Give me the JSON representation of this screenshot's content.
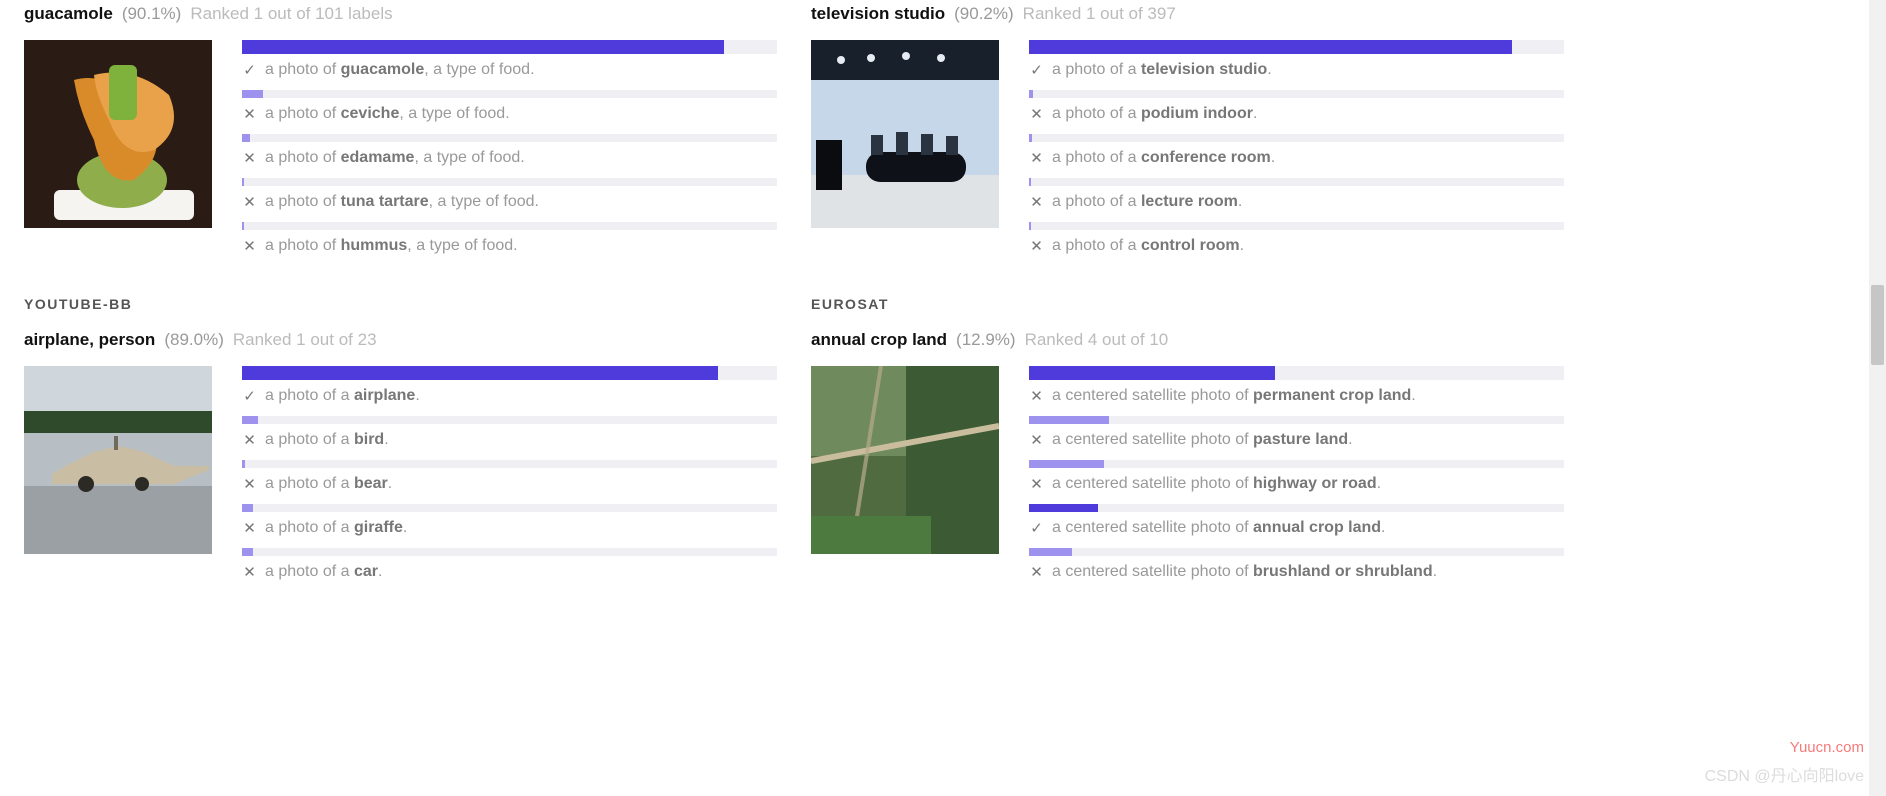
{
  "panels": [
    {
      "dataset_header": "",
      "label": "guacamole",
      "confidence": "(90.1%)",
      "rank": "Ranked 1 out of 101 labels",
      "predictions": [
        {
          "correct": true,
          "pct": 90.1,
          "prefix": "a photo of ",
          "term": "guacamole",
          "suffix": ", a type of food."
        },
        {
          "correct": false,
          "pct": 4.0,
          "prefix": "a photo of ",
          "term": "ceviche",
          "suffix": ", a type of food."
        },
        {
          "correct": false,
          "pct": 1.5,
          "prefix": "a photo of ",
          "term": "edamame",
          "suffix": ", a type of food."
        },
        {
          "correct": false,
          "pct": 0.4,
          "prefix": "a photo of ",
          "term": "tuna tartare",
          "suffix": ", a type of food."
        },
        {
          "correct": false,
          "pct": 0.4,
          "prefix": "a photo of ",
          "term": "hummus",
          "suffix": ", a type of food."
        }
      ]
    },
    {
      "dataset_header": "",
      "label": "television studio",
      "confidence": "(90.2%)",
      "rank": "Ranked 1 out of 397",
      "predictions": [
        {
          "correct": true,
          "pct": 90.2,
          "prefix": "a photo of a ",
          "term": "television studio",
          "suffix": "."
        },
        {
          "correct": false,
          "pct": 0.8,
          "prefix": "a photo of a ",
          "term": "podium indoor",
          "suffix": "."
        },
        {
          "correct": false,
          "pct": 0.5,
          "prefix": "a photo of a ",
          "term": "conference room",
          "suffix": "."
        },
        {
          "correct": false,
          "pct": 0.4,
          "prefix": "a photo of a ",
          "term": "lecture room",
          "suffix": "."
        },
        {
          "correct": false,
          "pct": 0.4,
          "prefix": "a photo of a ",
          "term": "control room",
          "suffix": "."
        }
      ]
    },
    {
      "dataset_header": "YOUTUBE-BB",
      "label": "airplane, person",
      "confidence": "(89.0%)",
      "rank": "Ranked 1 out of 23",
      "predictions": [
        {
          "correct": true,
          "pct": 89.0,
          "prefix": "a photo of a ",
          "term": "airplane",
          "suffix": "."
        },
        {
          "correct": false,
          "pct": 3.0,
          "prefix": "a photo of a ",
          "term": "bird",
          "suffix": "."
        },
        {
          "correct": false,
          "pct": 0.6,
          "prefix": "a photo of a ",
          "term": "bear",
          "suffix": "."
        },
        {
          "correct": false,
          "pct": 2.0,
          "prefix": "a photo of a ",
          "term": "giraffe",
          "suffix": "."
        },
        {
          "correct": false,
          "pct": 2.0,
          "prefix": "a photo of a ",
          "term": "car",
          "suffix": "."
        }
      ]
    },
    {
      "dataset_header": "EUROSAT",
      "label": "annual crop land",
      "confidence": "(12.9%)",
      "rank": "Ranked 4 out of 10",
      "predictions": [
        {
          "correct": false,
          "pct": 46.0,
          "prefix": "a centered satellite photo of ",
          "term": "permanent crop land",
          "suffix": "."
        },
        {
          "correct": false,
          "pct": 15.0,
          "prefix": "a centered satellite photo of ",
          "term": "pasture land",
          "suffix": "."
        },
        {
          "correct": false,
          "pct": 14.0,
          "prefix": "a centered satellite photo of ",
          "term": "highway or road",
          "suffix": "."
        },
        {
          "correct": true,
          "pct": 12.9,
          "prefix": "a centered satellite photo of ",
          "term": "annual crop land",
          "suffix": "."
        },
        {
          "correct": false,
          "pct": 8.0,
          "prefix": "a centered satellite photo of ",
          "term": "brushland or shrubland",
          "suffix": "."
        }
      ]
    }
  ],
  "watermark": {
    "top": "Yuucn.com",
    "bottom": "CSDN @丹心向阳love"
  },
  "icons": {
    "correct": "✓",
    "incorrect": "✕"
  },
  "thumbs": [
    "<svg width='188' height='188' viewBox='0 0 188 188'><rect width='188' height='188' fill='#2a1b14'/><rect x='30' y='150' width='140' height='30' rx='6' fill='#f5f4f0'/><ellipse cx='98' cy='140' rx='45' ry='28' fill='#8fae4b'/><path d='M50 40 Q85 30 120 70 Q150 110 110 140 Q80 145 70 100 Q55 70 50 40 Z' fill='#d98b2a'/><path d='M70 35 Q110 25 145 55 Q160 90 130 110 Q100 120 85 80 Q72 55 70 35 Z' fill='#e9a24a'/><rect x='85' y='25' width='28' height='55' rx='6' fill='#7fb23d'/></svg>",
    "<svg width='188' height='188' viewBox='0 0 188 188'><rect width='188' height='188' fill='#c7d7ea'/><rect x='0' y='0' width='188' height='40' fill='#18202c'/><rect x='0' y='135' width='188' height='53' fill='#dfe3e6'/><circle cx='30' cy='20' r='4' fill='#e7ecf2'/><circle cx='60' cy='18' r='4' fill='#e7ecf2'/><circle cx='95' cy='16' r='4' fill='#e7ecf2'/><circle cx='130' cy='18' r='4' fill='#e7ecf2'/><rect x='55' y='112' width='100' height='30' rx='14' fill='#0e1117'/><rect x='60' y='95' width='12' height='20' fill='#2a3440'/><rect x='85' y='92' width='12' height='23' fill='#2a3440'/><rect x='110' y='94' width='12' height='21' fill='#2a3440'/><rect x='135' y='96' width='12' height='19' fill='#2a3440'/><rect x='5' y='100' width='26' height='50' fill='#0a0c10'/></svg>",
    "<svg width='188' height='188' viewBox='0 0 188 188'><rect width='188' height='188' fill='#b7bfc5'/><rect x='0' y='0' width='188' height='62' fill='#cfd7dc'/><rect x='0' y='45' width='188' height='22' fill='#2f4a2a'/><rect x='0' y='120' width='188' height='68' fill='#9aa0a4'/><path d='M28 118 L150 118 L175 108 L185 104 L185 100 L150 100 L120 86 L95 80 L70 86 L45 98 L28 108 Z' fill='#c9bda3'/><circle cx='62' cy='118' r='8' fill='#2c2a24'/><circle cx='118' cy='118' r='7' fill='#2c2a24'/><rect x='90' y='70' width='4' height='14' fill='#6f6a5c'/></svg>",
    "<svg width='188' height='188' viewBox='0 0 188 188'><rect width='188' height='188' fill='#4f6b3f'/><rect x='0' y='0' width='95' height='90' fill='#6f8a5c'/><rect x='95' y='0' width='93' height='188' fill='#3c5a33'/><path d='M0 95 L188 60' stroke='#c9bd9e' stroke-width='6'/><path d='M70 0 L40 188' stroke='#b7ab8c' stroke-width='4' opacity='0.7'/><rect x='0' y='150' width='120' height='38' fill='#4d7a3f'/></svg>"
  ]
}
